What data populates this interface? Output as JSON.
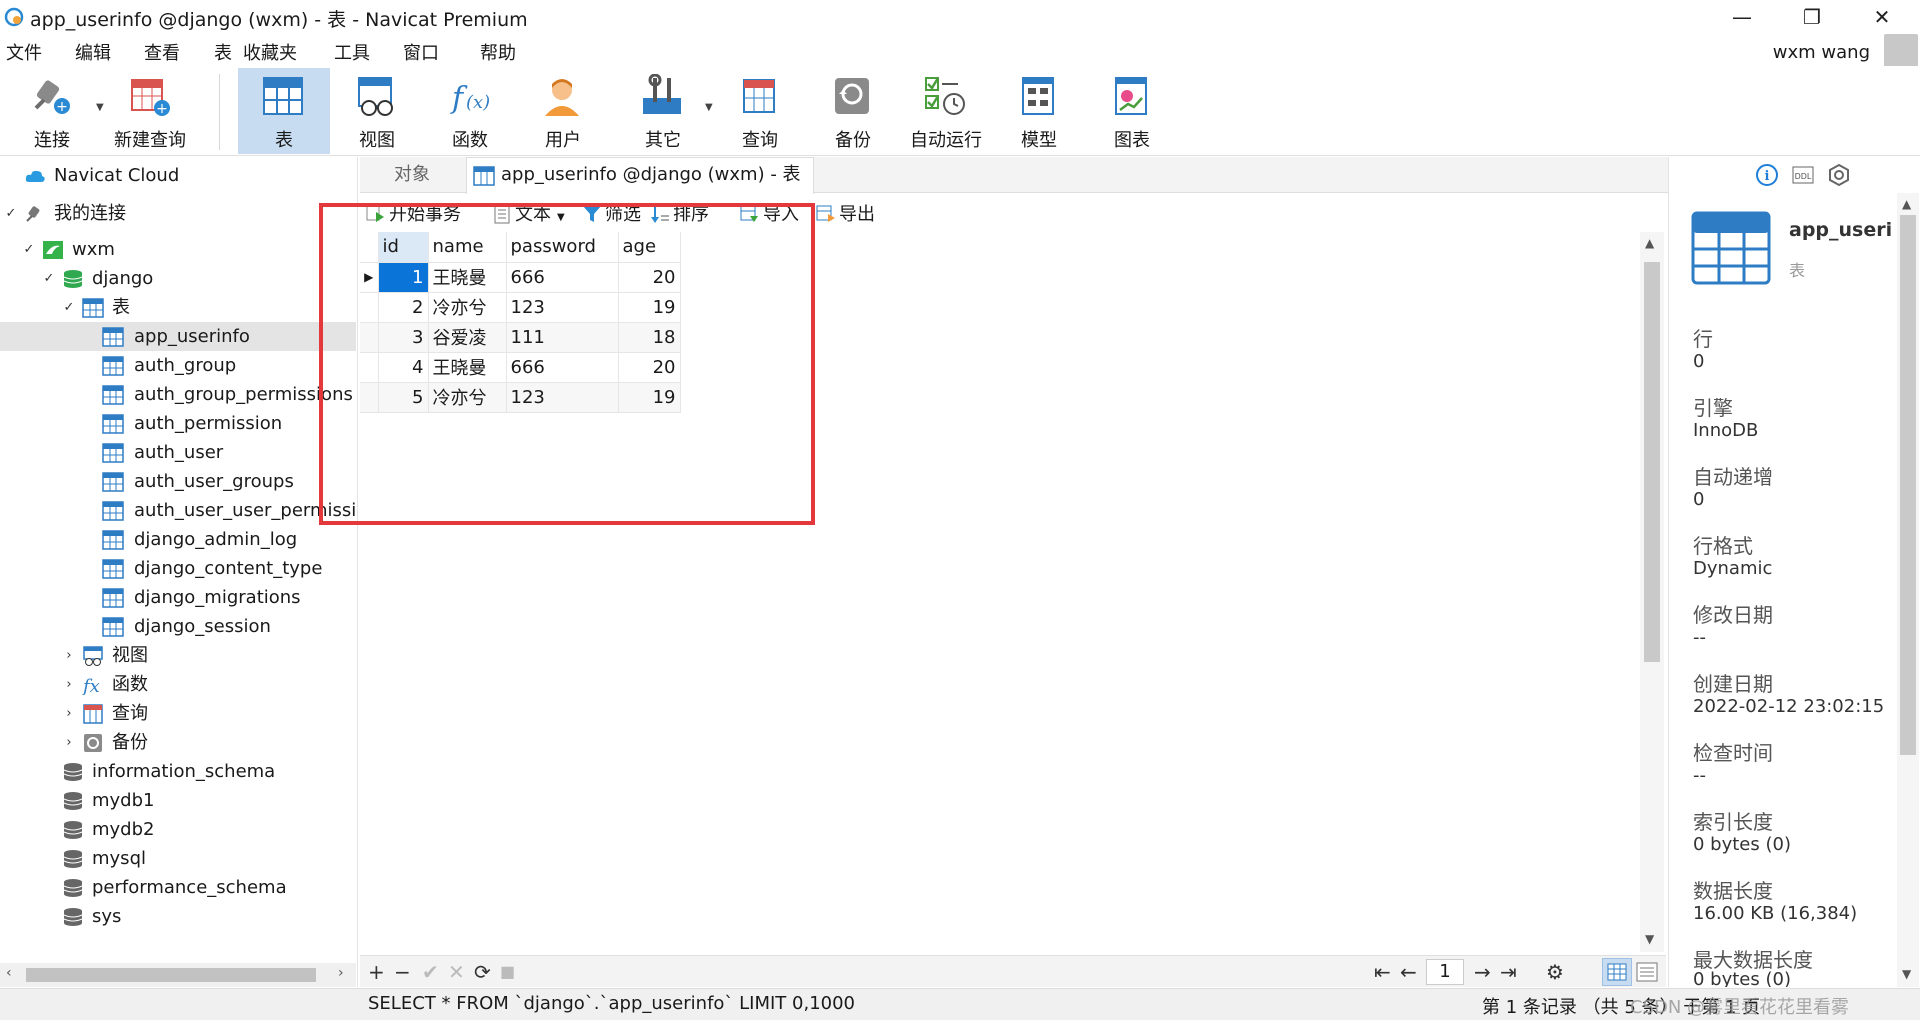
{
  "window": {
    "title": "app_userinfo @django (wxm) - 表 - Navicat Premium",
    "minimize_glyph": "—",
    "restore_glyph": "❐",
    "close_glyph": "✕"
  },
  "menu": [
    "文件",
    "编辑",
    "查看",
    "表",
    "收藏夹",
    "工具",
    "窗口",
    "帮助"
  ],
  "user": {
    "name": "wxm wang"
  },
  "toolbar": {
    "items": [
      {
        "label": "连接",
        "icon": "connection-plug-icon"
      },
      {
        "label": "新建查询",
        "icon": "new-query-icon"
      },
      {
        "label": "表",
        "icon": "table-icon",
        "active": true
      },
      {
        "label": "视图",
        "icon": "view-glasses-icon"
      },
      {
        "label": "函数",
        "icon": "function-fx-icon"
      },
      {
        "label": "用户",
        "icon": "user-icon"
      },
      {
        "label": "其它",
        "icon": "tools-icon"
      },
      {
        "label": "查询",
        "icon": "query-icon"
      },
      {
        "label": "备份",
        "icon": "backup-icon"
      },
      {
        "label": "自动运行",
        "icon": "automation-icon"
      },
      {
        "label": "模型",
        "icon": "model-icon"
      },
      {
        "label": "图表",
        "icon": "chart-icon"
      }
    ]
  },
  "tree": {
    "cloud": "Navicat Cloud",
    "my_connections": "我的连接",
    "connection": "wxm",
    "database": "django",
    "tables_group": "表",
    "tables": [
      "app_userinfo",
      "auth_group",
      "auth_group_permissions",
      "auth_permission",
      "auth_user",
      "auth_user_groups",
      "auth_user_user_permissions",
      "django_admin_log",
      "django_content_type",
      "django_migrations",
      "django_session"
    ],
    "views_group": "视图",
    "functions_group": "函数",
    "queries_group": "查询",
    "backups_group": "备份",
    "other_databases": [
      "information_schema",
      "mydb1",
      "mydb2",
      "mysql",
      "performance_schema",
      "sys"
    ]
  },
  "tabs": {
    "objects": "对象",
    "active": "app_userinfo @django (wxm) - 表"
  },
  "data_toolbar": {
    "begin_transaction": "开始事务",
    "text": "文本",
    "filter": "筛选",
    "sort": "排序",
    "import": "导入",
    "export": "导出"
  },
  "grid": {
    "columns": [
      "id",
      "name",
      "password",
      "age"
    ],
    "rows": [
      [
        "1",
        "王晓曼",
        "666",
        "20"
      ],
      [
        "2",
        "冷亦兮",
        "123",
        "19"
      ],
      [
        "3",
        "谷爱凌",
        "111",
        "18"
      ],
      [
        "4",
        "王晓曼",
        "666",
        "20"
      ],
      [
        "5",
        "冷亦兮",
        "123",
        "19"
      ]
    ]
  },
  "record_bar": {
    "add": "+",
    "remove": "−",
    "apply": "✔",
    "discard": "✕",
    "refresh": "⟳",
    "stop": "■",
    "first": "⇤",
    "prev": "←",
    "page": "1",
    "next": "→",
    "last": "⇥",
    "settings": "⚙"
  },
  "status": {
    "sql": "SELECT * FROM `django`.`app_userinfo` LIMIT 0,1000",
    "record_info": "第 1 条记录 （共 5 条） 于第 1 页",
    "watermark": "CSDN @雾里看花花里看雾"
  },
  "info_panel": {
    "name": "app_useri",
    "type": "表",
    "fields": [
      {
        "label": "行",
        "value": "0"
      },
      {
        "label": "引擎",
        "value": "InnoDB"
      },
      {
        "label": "自动递增",
        "value": "0"
      },
      {
        "label": "行格式",
        "value": "Dynamic"
      },
      {
        "label": "修改日期",
        "value": "--"
      },
      {
        "label": "创建日期",
        "value": "2022-02-12 23:02:15"
      },
      {
        "label": "检查时间",
        "value": "--"
      },
      {
        "label": "索引长度",
        "value": "0 bytes (0)"
      },
      {
        "label": "数据长度",
        "value": "16.00 KB (16,384)"
      },
      {
        "label": "最大数据长度",
        "value": "0 bytes (0)"
      }
    ]
  },
  "colors": {
    "selection_blue": "#0a74d8",
    "active_tool": "#c7dcf1",
    "highlight_red": "#e4393c",
    "table_icon_blue": "#2e7cc4"
  }
}
